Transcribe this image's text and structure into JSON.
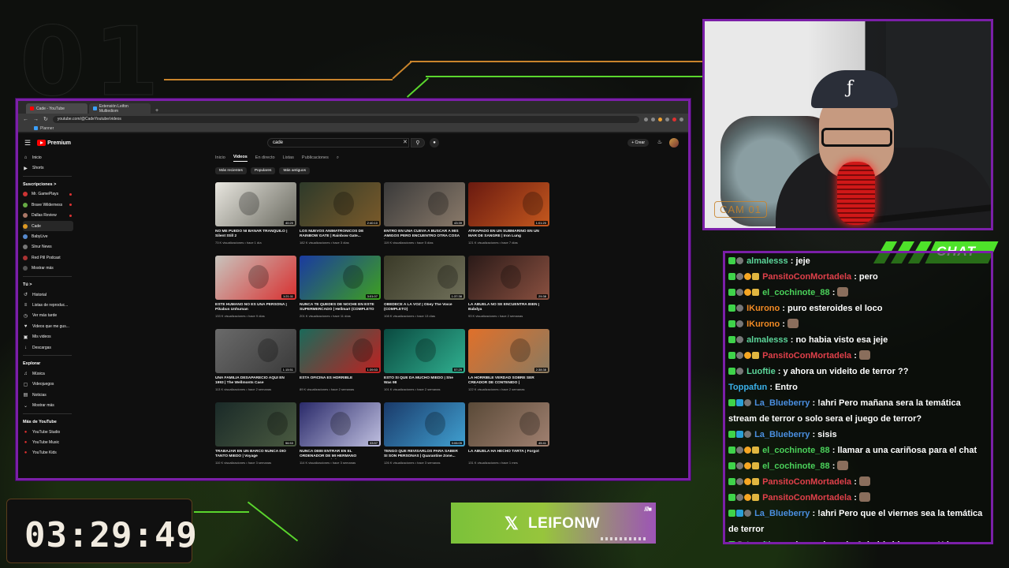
{
  "overlay": {
    "bg_number": "01",
    "cam_label": "CAM 01",
    "chat_title": "CHAT",
    "timer": "03:29:49",
    "social_handle": "LEIFONW",
    "accent_purple": "#7b1fa8",
    "accent_green": "#4ee22a",
    "accent_orange": "#c9842c"
  },
  "browser": {
    "tabs": [
      {
        "label": "Cade - YouTube",
        "icon": "youtube-icon"
      },
      {
        "label": "Extensión Leifon Multiediom",
        "icon": "extension-icon"
      }
    ],
    "url": "youtube.com/@CadeYoutube/videos",
    "bookmark": "Planner"
  },
  "youtube": {
    "logo": "Premium",
    "search_value": "cade",
    "create_label": "+ Crear",
    "sidebar": {
      "top": [
        {
          "label": "Inicio",
          "icon": "home-icon"
        },
        {
          "label": "Shorts",
          "icon": "shorts-icon"
        }
      ],
      "subs_heading": "Suscripciones >",
      "subs": [
        {
          "label": "Mr. GamePlays",
          "live": true
        },
        {
          "label": "Brave Wilderness",
          "live": true
        },
        {
          "label": "Dallas Review",
          "live": true
        },
        {
          "label": "Cade",
          "live": false
        },
        {
          "label": "BabyLive",
          "live": false
        },
        {
          "label": "Slnur News",
          "live": false
        },
        {
          "label": "Red Pill Podcast",
          "live": false
        },
        {
          "label": "Mostrar más",
          "live": false
        }
      ],
      "you_heading": "Tú >",
      "you": [
        {
          "label": "Historial",
          "icon": "history-icon"
        },
        {
          "label": "Listas de reproduc...",
          "icon": "playlist-icon"
        },
        {
          "label": "Ver más tarde",
          "icon": "clock-icon"
        },
        {
          "label": "Videos que me gus...",
          "icon": "like-icon"
        },
        {
          "label": "Mis videos",
          "icon": "video-icon"
        },
        {
          "label": "Descargas",
          "icon": "download-icon"
        }
      ],
      "explore_heading": "Explorar",
      "explore": [
        {
          "label": "Música",
          "icon": "music-icon"
        },
        {
          "label": "Videojuegos",
          "icon": "gamepad-icon"
        },
        {
          "label": "Noticias",
          "icon": "news-icon"
        },
        {
          "label": "Mostrar más",
          "icon": "chevron-down-icon"
        }
      ],
      "more_heading": "Más de YouTube",
      "more": [
        {
          "label": "YouTube Studio",
          "icon": "studio-icon"
        },
        {
          "label": "YouTube Music",
          "icon": "yt-music-icon"
        },
        {
          "label": "YouTube Kids",
          "icon": "yt-kids-icon"
        }
      ]
    },
    "channel_tabs": [
      "Inicio",
      "Videos",
      "En directo",
      "Listas",
      "Publicaciones"
    ],
    "chips": [
      "Más recientes",
      "Populares",
      "Más antiguos"
    ],
    "videos": [
      {
        "title": "NO ME PUEDO NI BAÑAR TRANQUILO | Silent Still 2",
        "meta": "73 K visualizaciones • hace 1 día",
        "duration": "40:20",
        "c1": "#e8e6df",
        "c2": "#6a6a60"
      },
      {
        "title": "LOS NUEVOS ANIMATRONICOS DE RAINBOW GATE | Rainbow Gate...",
        "meta": "182 K visualizaciones • hace 3 días",
        "duration": "2:40:10",
        "c1": "#2e3a2a",
        "c2": "#7a5a2a"
      },
      {
        "title": "ENTRO EN UNA CUEVA A BUSCAR A MIS AMIGOS PERO ENCUENTRO OTRA COSA |...",
        "meta": "119 K visualizaciones • hace 5 días",
        "duration": "43:39",
        "c1": "#3a3a3a",
        "c2": "#8a7a6a"
      },
      {
        "title": "ATRAPADO EN UN SUBMARINO EN UN MAR DE SANGRE | Iron Lung",
        "meta": "121 K visualizaciones • hace 7 días",
        "duration": "1:01:20",
        "c1": "#6a1a10",
        "c2": "#c4581e"
      },
      {
        "title": "ESTE HUMANO NO ES UNA PERSONA | Pikabus Unhuman",
        "meta": "133 K visualizaciones • hace 9 días",
        "duration": "1:21:11",
        "c1": "#c8c4bd",
        "c2": "#d83030"
      },
      {
        "title": "NUNCA TE QUEDES DE NOCHE EN ESTE SUPERMERCADO | Hellmart (COMPLETO Y...",
        "meta": "201 K visualizaciones • hace 11 días",
        "duration": "3:01:07",
        "c1": "#1a3aa0",
        "c2": "#3ea020"
      },
      {
        "title": "OBEDECE A LA VOZ | Obey The Voice (COMPLETO)",
        "meta": "108 K visualizaciones • hace 13 días",
        "duration": "1:37:38",
        "c1": "#3a3a28",
        "c2": "#70705a"
      },
      {
        "title": "LA ABUELA NO SE ENCUENTRA BIEN | Babdya",
        "meta": "93 K visualizaciones • hace 2 semanas",
        "duration": "29:38",
        "c1": "#2a1a18",
        "c2": "#8a5040"
      },
      {
        "title": "UNA FAMILIA DESAPARECIO AQUI EN 1993 | The Wellmonts Case",
        "meta": "113 K visualizaciones • hace 2 semanas",
        "duration": "1:15:51",
        "c1": "#6a6a6a",
        "c2": "#3a3a3a"
      },
      {
        "title": "ESTA OFICINA ES HORRIBLE",
        "meta": "89 K visualizaciones • hace 2 semanas",
        "duration": "1:39:53",
        "c1": "#1a6a5a",
        "c2": "#c02020"
      },
      {
        "title": "ESTO SI QUE DA MUCHO MIEDO | She Was 98",
        "meta": "101 K visualizaciones • hace 2 semanas",
        "duration": "57:29",
        "c1": "#0a4a40",
        "c2": "#30b090"
      },
      {
        "title": "LA HORRIBLE VERDAD SOBRE SER CREADOR DE CONTENIDO | BrokenLore...",
        "meta": "122 K visualizaciones • hace 2 semanas",
        "duration": "2:38:38",
        "c1": "#e0702a",
        "c2": "#8a7a60"
      },
      {
        "title": "TRABAJAR EN UN BARCO NUNCA DIO TANTO MIEDO | Voyage",
        "meta": "110 K visualizaciones • hace 3 semanas",
        "duration": "56:53",
        "c1": "#1a2a28",
        "c2": "#4a5a40"
      },
      {
        "title": "NUNCA DEBI ENTRAR EN EL ORDENADOR DE MI HERMANO DESAPARECIDO | The...",
        "meta": "114 K visualizaciones • hace 3 semanas",
        "duration": "33:57",
        "c1": "#2a2a6a",
        "c2": "#c0c0e0"
      },
      {
        "title": "TENGO QUE REVISARLOS PARA SABER SI SON PERSONAS | Quarantine Zone...",
        "meta": "126 K visualizaciones • hace 3 semanas",
        "duration": "3:06:05",
        "c1": "#1a3a6a",
        "c2": "#40a0d0"
      },
      {
        "title": "LA ABUELA HA HECHO TARTA | Forgot",
        "meta": "131 K visualizaciones • hace 1 mes",
        "duration": "45:41",
        "c1": "#5a4a38",
        "c2": "#a08070"
      }
    ]
  },
  "chat": {
    "messages": [
      {
        "badges": [
          "b-green",
          "b-gray"
        ],
        "user": "almalesss",
        "color": "#5cd69a",
        "text": ": jeje",
        "emote": false
      },
      {
        "badges": [
          "b-green",
          "b-gray",
          "b-orange",
          "b-gold"
        ],
        "user": "PansitoConMortadela",
        "color": "#e0404a",
        "text": ": pero",
        "emote": false
      },
      {
        "badges": [
          "b-green",
          "b-gray",
          "b-orange",
          "b-gold"
        ],
        "user": "el_cochinote_88",
        "color": "#4ad15a",
        "text": ":",
        "emote": true
      },
      {
        "badges": [
          "b-green",
          "b-gray"
        ],
        "user": "IKurono",
        "color": "#f08a24",
        "text": ": puro esteroides el loco",
        "emote": false
      },
      {
        "badges": [
          "b-green",
          "b-gray"
        ],
        "user": "IKurono",
        "color": "#f08a24",
        "text": ":",
        "emote": true
      },
      {
        "badges": [
          "b-green",
          "b-gray"
        ],
        "user": "almalesss",
        "color": "#5cd69a",
        "text": ": no habia visto esa jeje",
        "emote": false
      },
      {
        "badges": [
          "b-green",
          "b-gray",
          "b-orange",
          "b-gold"
        ],
        "user": "PansitoConMortadela",
        "color": "#e0404a",
        "text": ":",
        "emote": true
      },
      {
        "badges": [
          "b-green",
          "b-gray"
        ],
        "user": "Luoftie",
        "color": "#5cd69a",
        "text": ": y ahora un videito de terror ??",
        "emote": false
      },
      {
        "badges": [],
        "user": "Toppafun",
        "color": "#3ab0e8",
        "text": ": Entro",
        "emote": false
      },
      {
        "badges": [
          "b-green",
          "b-blue",
          "b-gray"
        ],
        "user": "La_Blueberry",
        "color": "#4a8fe0",
        "text": ": !ahri Pero mañana sera la temática stream de terror o solo sera el juego de terror?",
        "emote": false
      },
      {
        "badges": [
          "b-green",
          "b-blue",
          "b-gray"
        ],
        "user": "La_Blueberry",
        "color": "#4a8fe0",
        "text": ": sisis",
        "emote": false
      },
      {
        "badges": [
          "b-green",
          "b-gray",
          "b-orange",
          "b-gold"
        ],
        "user": "el_cochinote_88",
        "color": "#4ad15a",
        "text": ": llamar a una cariñosa para el chat",
        "emote": false
      },
      {
        "badges": [
          "b-green",
          "b-gray",
          "b-orange",
          "b-gold"
        ],
        "user": "el_cochinote_88",
        "color": "#4ad15a",
        "text": ":",
        "emote": true
      },
      {
        "badges": [
          "b-green",
          "b-gray",
          "b-orange",
          "b-gold"
        ],
        "user": "PansitoConMortadela",
        "color": "#e0404a",
        "text": ":",
        "emote": true
      },
      {
        "badges": [
          "b-green",
          "b-gray",
          "b-orange",
          "b-gold"
        ],
        "user": "PansitoConMortadela",
        "color": "#e0404a",
        "text": ":",
        "emote": true
      },
      {
        "badges": [
          "b-green",
          "b-blue",
          "b-gray"
        ],
        "user": "La_Blueberry",
        "color": "#4a8fe0",
        "text": ": !ahri Pero que el viernes sea la temática de terror",
        "emote": false
      },
      {
        "badges": [
          "b-green",
          "b-gray"
        ],
        "user": "Luoftie",
        "color": "#5cd69a",
        "text": ": qué cosa jugarán ?, había ido a mear Xd",
        "emote": false
      }
    ]
  }
}
